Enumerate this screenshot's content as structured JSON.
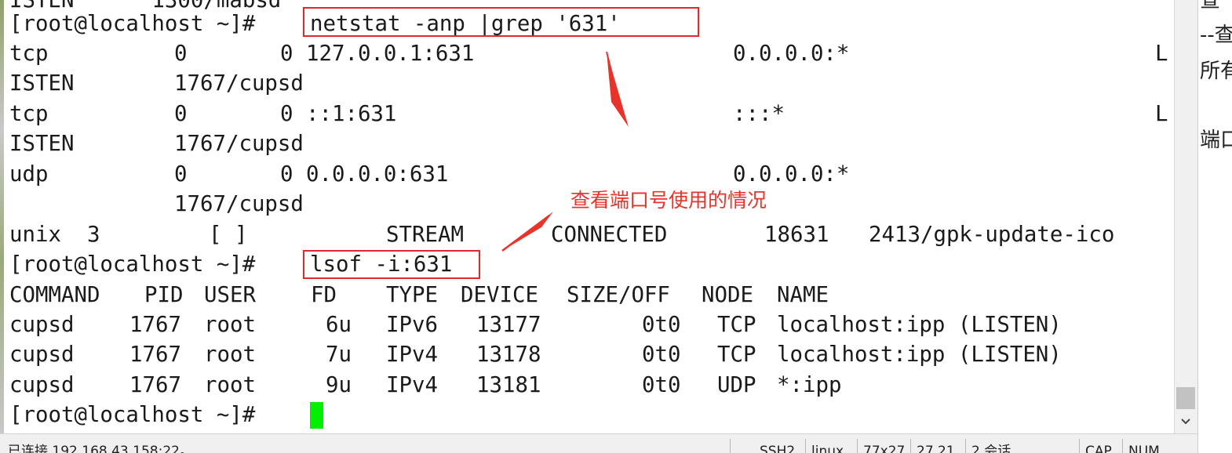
{
  "terminal": {
    "partial_top_line": "ISTEN      1300/mabsd",
    "lines": [
      {
        "id": "cmd1",
        "prompt": "[root@localhost ~]#",
        "command": "netstat -anp |grep '631'"
      },
      {
        "id": "tcp1",
        "c0": "tcp",
        "c1": "0",
        "c2": "0 127.0.0.1:631",
        "c3": "0.0.0.0:*",
        "c4": "L"
      },
      {
        "id": "tcp1b",
        "c0": "ISTEN",
        "c1": "1767/cupsd"
      },
      {
        "id": "tcp2",
        "c0": "tcp",
        "c1": "0",
        "c2": "0 ::1:631",
        "c3": ":::*",
        "c4": "L"
      },
      {
        "id": "tcp2b",
        "c0": "ISTEN",
        "c1": "1767/cupsd"
      },
      {
        "id": "udp1",
        "c0": "udp",
        "c1": "0",
        "c2": "0 0.0.0.0:631",
        "c3": "0.0.0.0:*"
      },
      {
        "id": "udp1b",
        "c1": "1767/cupsd"
      },
      {
        "id": "unix1",
        "c0": "unix  3",
        "c1": "[ ]",
        "c2": "STREAM",
        "c3": "CONNECTED",
        "c4": "18631",
        "c5": "2413/gpk-update-ico"
      },
      {
        "id": "cmd2",
        "prompt": "[root@localhost ~]#",
        "command": "lsof -i:631"
      }
    ],
    "lsof": {
      "headers": [
        "COMMAND",
        "PID",
        "USER",
        "FD",
        "TYPE",
        "DEVICE",
        "SIZE/OFF",
        "NODE",
        "NAME"
      ],
      "rows": [
        [
          "cupsd",
          "1767",
          "root",
          "6u",
          "IPv6",
          "13177",
          "0t0",
          "TCP",
          "localhost:ipp (LISTEN)"
        ],
        [
          "cupsd",
          "1767",
          "root",
          "7u",
          "IPv4",
          "13178",
          "0t0",
          "TCP",
          "localhost:ipp (LISTEN)"
        ],
        [
          "cupsd",
          "1767",
          "root",
          "9u",
          "IPv4",
          "13181",
          "0t0",
          "UDP",
          "*:ipp"
        ]
      ]
    },
    "final_prompt": "[root@localhost ~]#"
  },
  "annotation": {
    "label": "查看端口号使用的情况",
    "color": "#e8332a"
  },
  "doc_strip": {
    "fragments": [
      "查",
      "--查",
      "所有",
      "端口"
    ]
  },
  "statusbar": {
    "connection": "已连接 192.168.43.158:22。",
    "protocol": "SSH2",
    "terminal_type": "linux",
    "size": "77x27",
    "cursor_pos": "27,21",
    "sessions": "2 会话",
    "cap": "CAP",
    "num": "NUM"
  },
  "colors": {
    "highlight_box": "#e0282d",
    "cursor": "#00f000",
    "terminal_text": "#1a1a1a",
    "terminal_bg": "#ffffff"
  },
  "icons": {
    "scroll_down": "chevron-down-icon"
  }
}
